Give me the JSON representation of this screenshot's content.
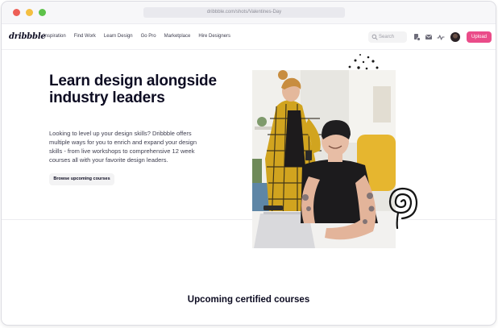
{
  "browser": {
    "url": "dribbble.com/shots/Valentines-Day"
  },
  "nav": {
    "logo": "dribbble",
    "links": [
      "Inspiration",
      "Find Work",
      "Learn Design",
      "Go Pro",
      "Marketplace",
      "Hire Designers"
    ],
    "search_placeholder": "Search",
    "upload_label": "Upload"
  },
  "hero": {
    "title": "Learn design alongside industry leaders",
    "description": "Looking to level up your design skills? Dribbble offers multiple ways for you to enrich and expand your design skills - from live workshops to comprehensive 12 week courses all with your favorite design leaders.",
    "cta_label": "Browse upcoming courses"
  },
  "section": {
    "title": "Upcoming certified courses"
  },
  "colors": {
    "accent": "#ea4c89",
    "text": "#0d0c22"
  }
}
